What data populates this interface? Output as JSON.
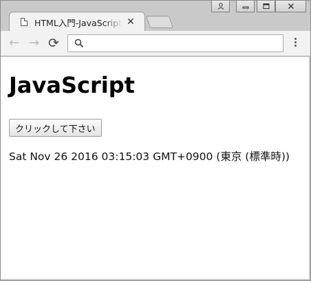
{
  "window": {
    "controls": {
      "user_glyph": "👤",
      "minimize_glyph": "—",
      "maximize_glyph": "▢",
      "close_glyph": "✕"
    }
  },
  "tab": {
    "title": "HTML入門-JavaScriptの",
    "close_glyph": "✕",
    "favicon": "page-icon"
  },
  "toolbar": {
    "back_glyph": "←",
    "forward_glyph": "→",
    "reload_glyph": "⟳",
    "search": {
      "value": "",
      "placeholder": "",
      "icon": "search-icon"
    },
    "menu_icon": "more-vert-icon"
  },
  "page": {
    "heading": "JavaScript",
    "button_label": "クリックして下さい",
    "date_text": "Sat Nov 26 2016 03:15:03 GMT+0900 (東京 (標準時))"
  },
  "colors": {
    "chrome_bg": "#c9c9c9",
    "toolbar_bg": "#f2f2f2",
    "page_bg": "#ffffff"
  }
}
